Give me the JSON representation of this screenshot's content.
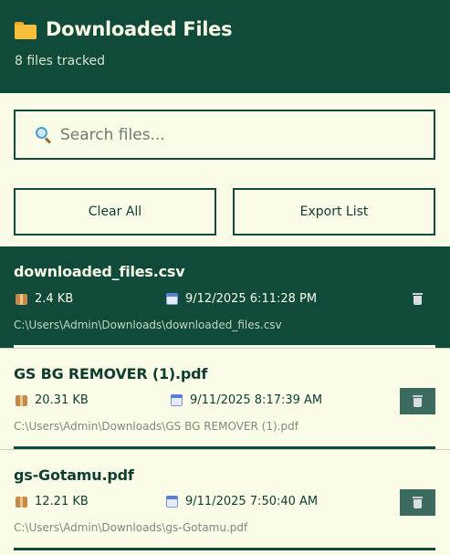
{
  "header": {
    "title": "Downloaded Files",
    "subtitle": "8 files tracked",
    "icon": "folder-icon"
  },
  "search": {
    "placeholder": "Search files...",
    "value": "",
    "icon": "search-icon"
  },
  "actions": {
    "clear_label": "Clear All",
    "export_label": "Export List"
  },
  "files": [
    {
      "name": "downloaded_files.csv",
      "size": "2.4 KB",
      "date": "9/12/2025 6:11:28 PM",
      "path": "C:\\Users\\Admin\\Downloads\\downloaded_files.csv",
      "selected": true
    },
    {
      "name": "GS BG REMOVER (1).pdf",
      "size": "20.31 KB",
      "date": "9/11/2025 8:17:39 AM",
      "path": "C:\\Users\\Admin\\Downloads\\GS BG REMOVER (1).pdf",
      "selected": false
    },
    {
      "name": "gs-Gotamu.pdf",
      "size": "12.21 KB",
      "date": "9/11/2025 7:50:40 AM",
      "path": "C:\\Users\\Admin\\Downloads\\gs-Gotamu.pdf",
      "selected": false
    }
  ],
  "colors": {
    "primary": "#0f4a3a",
    "background": "#fbfce8",
    "trash_button": "#3a6b5e"
  }
}
